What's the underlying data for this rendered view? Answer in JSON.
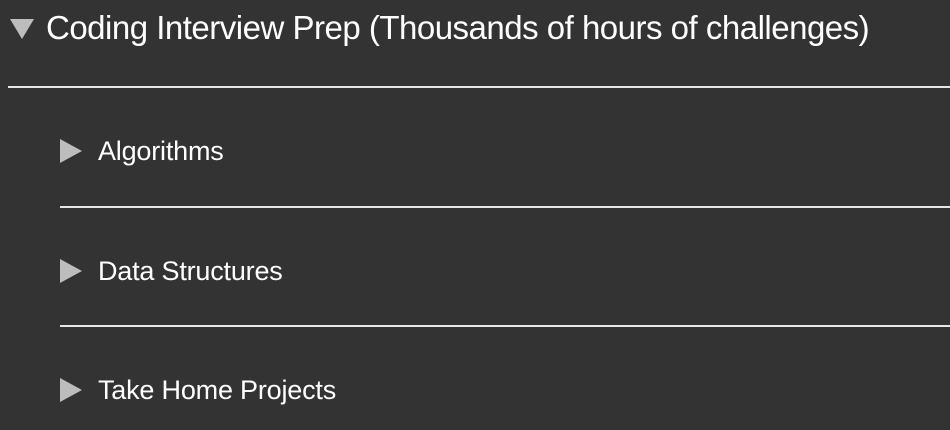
{
  "superblock": {
    "title": "Coding Interview Prep (Thousands of hours of challenges)",
    "expanded_icon": "triangle-down-icon",
    "blocks": [
      {
        "label": "Algorithms",
        "icon": "triangle-right-icon"
      },
      {
        "label": "Data Structures",
        "icon": "triangle-right-icon"
      },
      {
        "label": "Take Home Projects",
        "icon": "triangle-right-icon"
      }
    ]
  },
  "colors": {
    "background": "#333333",
    "text": "#ffffff",
    "caret": "#bdbdbd",
    "divider": "#e6e6e6"
  }
}
